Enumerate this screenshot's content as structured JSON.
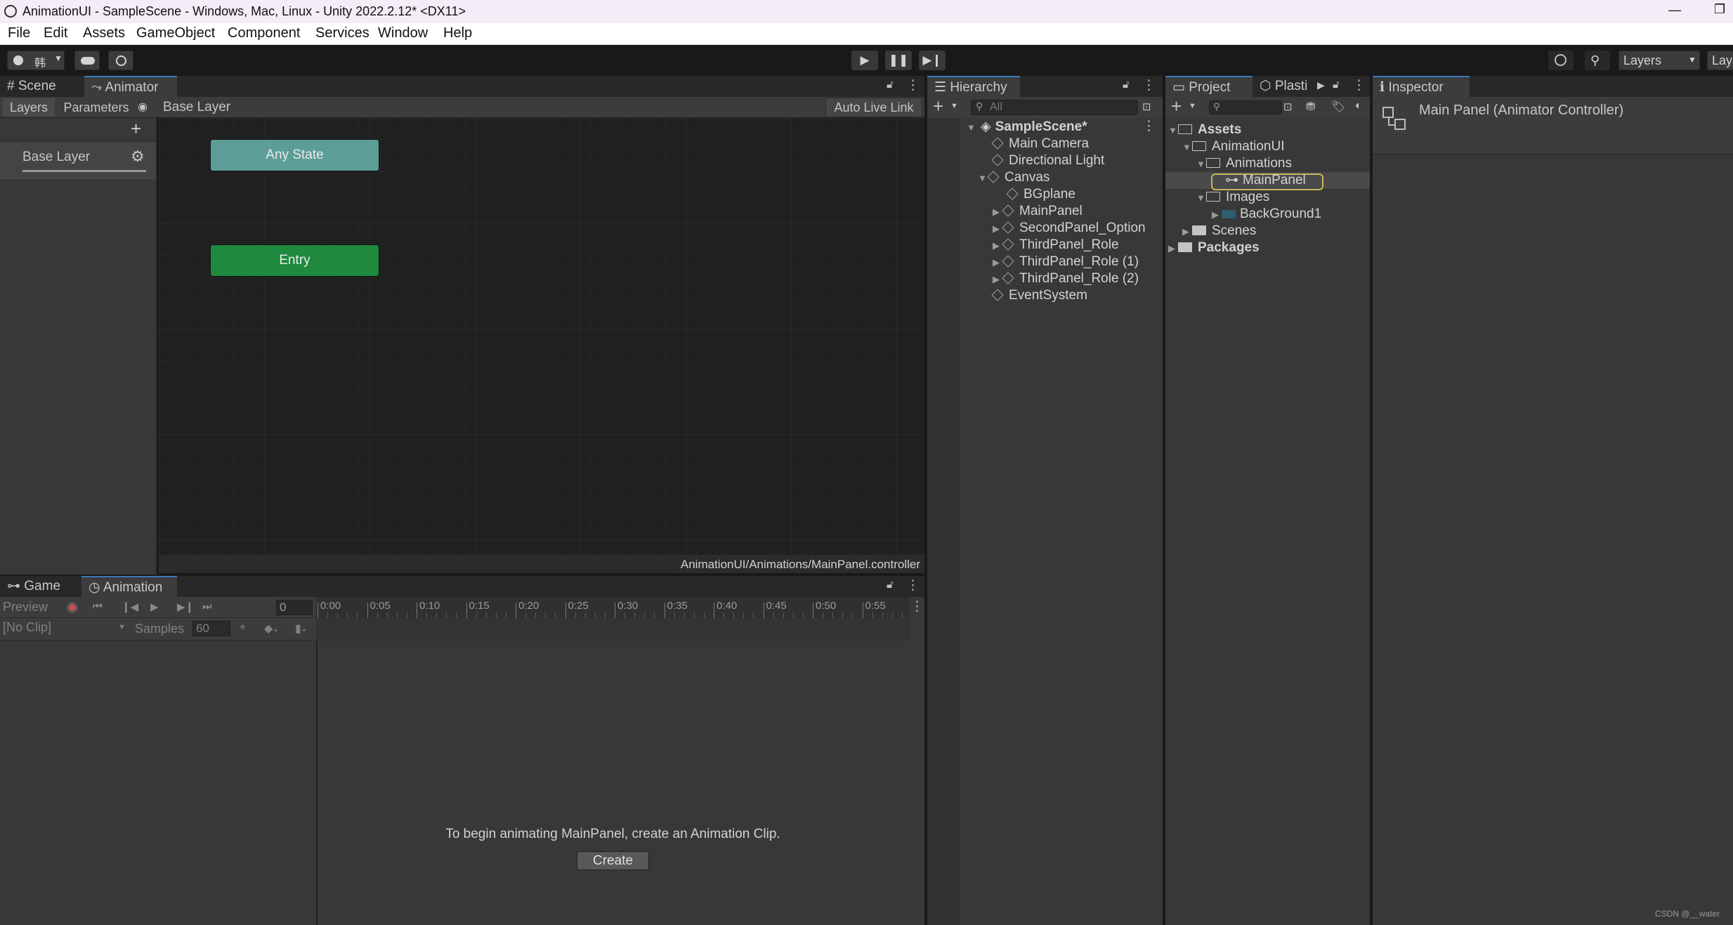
{
  "window": {
    "title": "AnimationUI - SampleScene - Windows, Mac, Linux - Unity 2022.2.12* <DX11>",
    "minimize_glyph": "—",
    "restore_glyph": "❐"
  },
  "menu": [
    "File",
    "Edit",
    "Assets",
    "GameObject",
    "Component",
    "Services",
    "Window",
    "Help"
  ],
  "toolbar": {
    "account_label": "韩",
    "layers_label": "Layers",
    "layout_label": "Lay"
  },
  "animator": {
    "tabs": {
      "scene": "Scene",
      "animator": "Animator"
    },
    "subtabs": {
      "layers": "Layers",
      "parameters": "Parameters"
    },
    "breadcrumb": "Base Layer",
    "auto_live_link": "Auto Live Link",
    "layer_item": "Base Layer",
    "nodes": {
      "any_state": "Any State",
      "entry": "Entry"
    },
    "node_colors": {
      "any_state": "#5c9e97",
      "entry": "#1f8a3d"
    },
    "path": "AnimationUI/Animations/MainPanel.controller"
  },
  "animation": {
    "tabs": {
      "game": "Game",
      "animation": "Animation"
    },
    "preview_label": "Preview",
    "frame_value": "0",
    "clip_value": "[No Clip]",
    "samples_label": "Samples",
    "samples_value": "60",
    "timeline_ticks": [
      "0:00",
      "0:05",
      "0:10",
      "0:15",
      "0:20",
      "0:25",
      "0:30",
      "0:35",
      "0:40",
      "0:45",
      "0:50",
      "0:55"
    ],
    "message": "To begin animating MainPanel, create an Animation Clip.",
    "create_button": "Create"
  },
  "hierarchy": {
    "tab": "Hierarchy",
    "search_placeholder": "All",
    "scene": "SampleScene*",
    "items": [
      "Main Camera",
      "Directional Light",
      "Canvas",
      "BGplane",
      "MainPanel",
      "SecondPanel_Option",
      "ThirdPanel_Role",
      "ThirdPanel_Role (1)",
      "ThirdPanel_Role (2)",
      "EventSystem"
    ]
  },
  "project": {
    "tabs": {
      "project": "Project",
      "plastic": "Plasti"
    },
    "tree": {
      "assets": "Assets",
      "animationui": "AnimationUI",
      "animations": "Animations",
      "mainpanel": "MainPanel",
      "images": "Images",
      "background1": "BackGround1",
      "scenes": "Scenes",
      "packages": "Packages"
    },
    "selected_outline": "#c9b65b"
  },
  "inspector": {
    "tab": "Inspector",
    "title": "Main Panel (Animator Controller)"
  },
  "watermark": "CSDN @__water",
  "colors": {
    "accent": "#3a79bb"
  }
}
